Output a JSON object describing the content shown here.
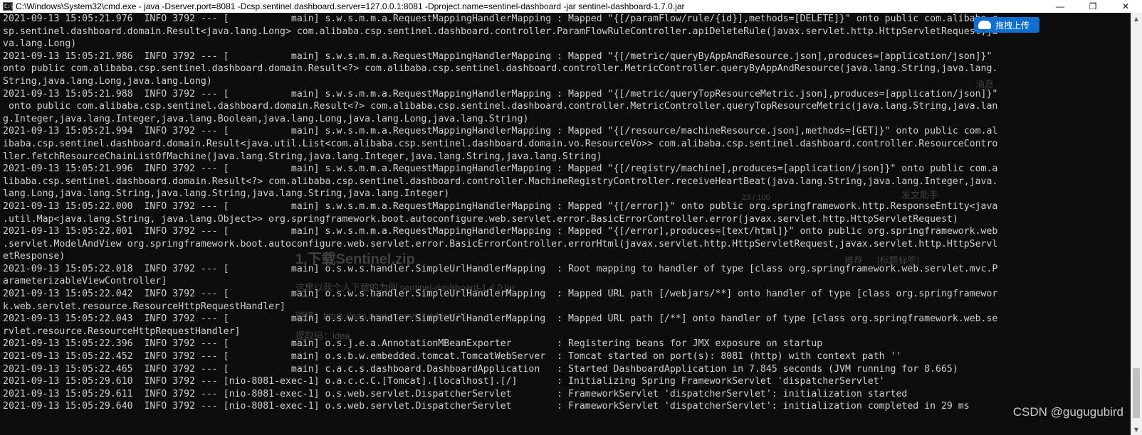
{
  "window": {
    "title": "C:\\Windows\\System32\\cmd.exe - java   -Dserver.port=8081 -Dcsp.sentinel.dashboard.server=127.0.0.1:8081 -Dproject.name=sentinel-dashboard -jar sentinel-dashboard-1.7.0.jar",
    "icon_text": "C:\\",
    "minimize": "—",
    "maximize": "❐",
    "close": "✕"
  },
  "console_lines": [
    "2021-09-13 15:05:21.976  INFO 3792 --- [           main] s.w.s.m.m.a.RequestMappingHandlerMapping : Mapped \"{[/paramFlow/rule/{id}],methods=[DELETE]}\" onto public com.alibaba.c",
    "sp.sentinel.dashboard.domain.Result<java.lang.Long> com.alibaba.csp.sentinel.dashboard.controller.ParamFlowRuleController.apiDeleteRule(javax.servlet.http.HttpServletRequest,ja",
    "va.lang.Long)",
    "2021-09-13 15:05:21.986  INFO 3792 --- [           main] s.w.s.m.m.a.RequestMappingHandlerMapping : Mapped \"{[/metric/queryByAppAndResource.json],produces=[application/json]}\"",
    "onto public com.alibaba.csp.sentinel.dashboard.domain.Result<?> com.alibaba.csp.sentinel.dashboard.controller.MetricController.queryByAppAndResource(java.lang.String,java.lang.",
    "String,java.lang.Long,java.lang.Long)",
    "2021-09-13 15:05:21.988  INFO 3792 --- [           main] s.w.s.m.m.a.RequestMappingHandlerMapping : Mapped \"{[/metric/queryTopResourceMetric.json],produces=[application/json]}\"",
    " onto public com.alibaba.csp.sentinel.dashboard.domain.Result<?> com.alibaba.csp.sentinel.dashboard.controller.MetricController.queryTopResourceMetric(java.lang.String,java.lan",
    "g.Integer,java.lang.Integer,java.lang.Boolean,java.lang.Long,java.lang.Long,java.lang.String)",
    "2021-09-13 15:05:21.994  INFO 3792 --- [           main] s.w.s.m.m.a.RequestMappingHandlerMapping : Mapped \"{[/resource/machineResource.json],methods=[GET]}\" onto public com.al",
    "ibaba.csp.sentinel.dashboard.domain.Result<java.util.List<com.alibaba.csp.sentinel.dashboard.domain.vo.ResourceVo>> com.alibaba.csp.sentinel.dashboard.controller.ResourceContro",
    "ller.fetchResourceChainListOfMachine(java.lang.String,java.lang.Integer,java.lang.String,java.lang.String)",
    "2021-09-13 15:05:21.996  INFO 3792 --- [           main] s.w.s.m.m.a.RequestMappingHandlerMapping : Mapped \"{[/registry/machine],produces=[application/json]}\" onto public com.a",
    "libaba.csp.sentinel.dashboard.domain.Result<?> com.alibaba.csp.sentinel.dashboard.controller.MachineRegistryController.receiveHeartBeat(java.lang.String,java.lang.Integer,java.",
    "lang.Long,java.lang.String,java.lang.String,java.lang.String,java.lang.Integer)",
    "2021-09-13 15:05:22.000  INFO 3792 --- [           main] s.w.s.m.m.a.RequestMappingHandlerMapping : Mapped \"{[/error]}\" onto public org.springframework.http.ResponseEntity<java",
    ".util.Map<java.lang.String, java.lang.Object>> org.springframework.boot.autoconfigure.web.servlet.error.BasicErrorController.error(javax.servlet.http.HttpServletRequest)",
    "2021-09-13 15:05:22.001  INFO 3792 --- [           main] s.w.s.m.m.a.RequestMappingHandlerMapping : Mapped \"{[/error],produces=[text/html]}\" onto public org.springframework.web",
    ".servlet.ModelAndView org.springframework.boot.autoconfigure.web.servlet.error.BasicErrorController.errorHtml(javax.servlet.http.HttpServletRequest,javax.servlet.http.HttpServl",
    "etResponse)",
    "2021-09-13 15:05:22.018  INFO 3792 --- [           main] o.s.w.s.handler.SimpleUrlHandlerMapping  : Root mapping to handler of type [class org.springframework.web.servlet.mvc.P",
    "arameterizableViewController]",
    "2021-09-13 15:05:22.042  INFO 3792 --- [           main] o.s.w.s.handler.SimpleUrlHandlerMapping  : Mapped URL path [/webjars/**] onto handler of type [class org.springframewor",
    "k.web.servlet.resource.ResourceHttpRequestHandler]",
    "2021-09-13 15:05:22.043  INFO 3792 --- [           main] o.s.w.s.handler.SimpleUrlHandlerMapping  : Mapped URL path [/**] onto handler of type [class org.springframework.web.se",
    "rvlet.resource.ResourceHttpRequestHandler]",
    "2021-09-13 15:05:22.396  INFO 3792 --- [           main] o.s.j.e.a.AnnotationMBeanExporter        : Registering beans for JMX exposure on startup",
    "2021-09-13 15:05:22.452  INFO 3792 --- [           main] o.s.b.w.embedded.tomcat.TomcatWebServer  : Tomcat started on port(s): 8081 (http) with context path ''",
    "2021-09-13 15:05:22.465  INFO 3792 --- [           main] c.a.c.s.dashboard.DashboardApplication   : Started DashboardApplication in 7.845 seconds (JVM running for 8.665)",
    "2021-09-13 15:05:29.610  INFO 3792 --- [nio-8081-exec-1] o.a.c.c.C.[Tomcat].[localhost].[/]       : Initializing Spring FrameworkServlet 'dispatcherServlet'",
    "2021-09-13 15:05:29.611  INFO 3792 --- [nio-8081-exec-1] o.s.web.servlet.DispatcherServlet        : FrameworkServlet 'dispatcherServlet': initialization started",
    "2021-09-13 15:05:29.640  INFO 3792 --- [nio-8081-exec-1] o.s.web.servlet.DispatcherServlet        : FrameworkServlet 'dispatcherServlet': initialization completed in 29 ms"
  ],
  "overlay": {
    "upload_label": "拖拽上传",
    "watermark": "CSDN @gugugubird"
  },
  "ghost_text": {
    "heading_1": "1.下载Sentinel.zip",
    "para_1": "这里以我个人下载的为例 sentinel-dashboard-1.4.0.jar",
    "link_1": "链接：https://pan.baidu.com/s/1gvkkwQC...",
    "code_1": "提取码：idea",
    "msg": "消息",
    "assist": "发文助手",
    "recommend": "推荐",
    "tag": "[标题标签]",
    "counter": "23 / 100"
  },
  "colors": {
    "console_bg": "#0c0c0c",
    "console_text": "#cfcfcf",
    "upload_blue": "#0e6fd0"
  }
}
